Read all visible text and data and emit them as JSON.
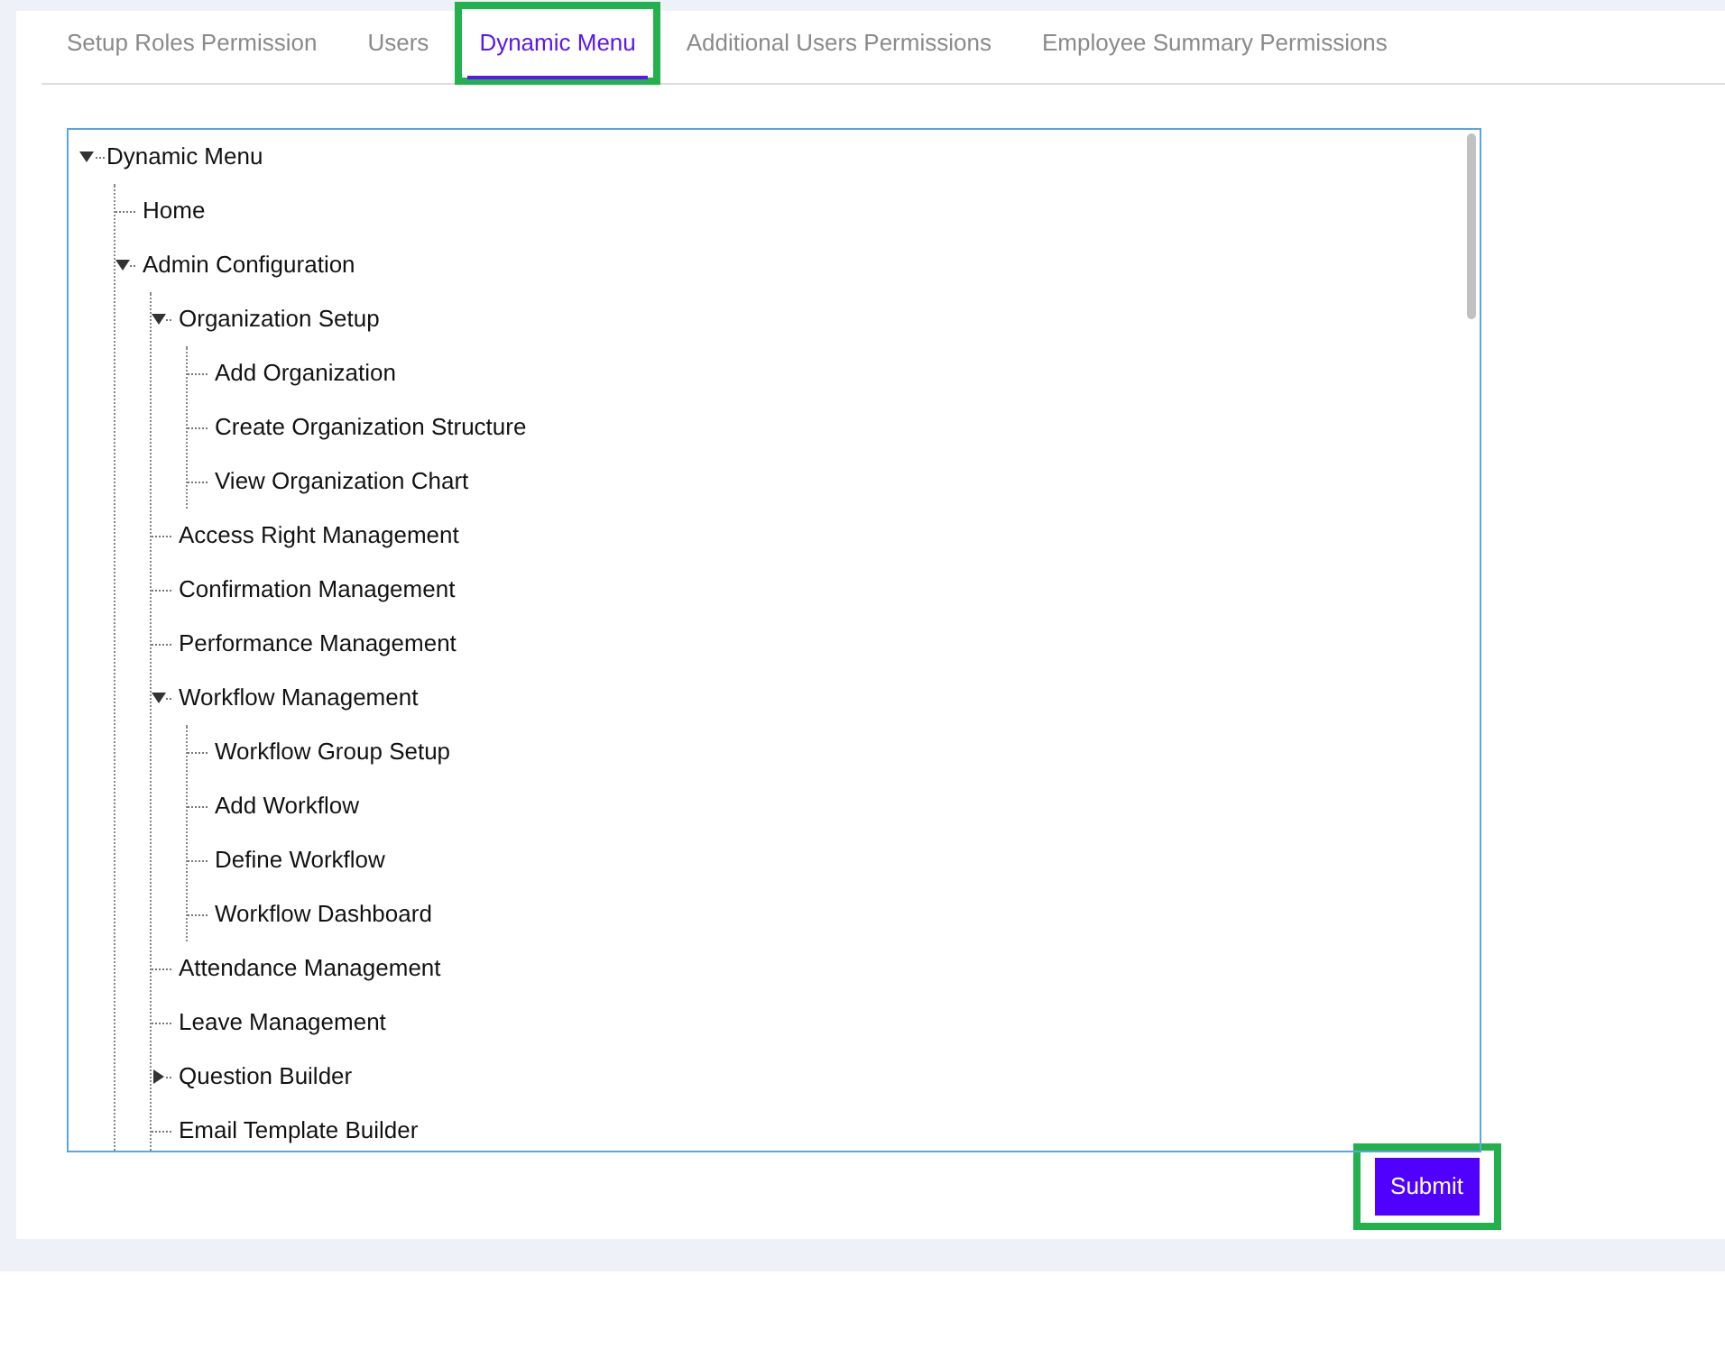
{
  "tabs": [
    {
      "label": "Setup Roles Permission",
      "selected": false,
      "highlighted": false
    },
    {
      "label": "Users",
      "selected": false,
      "highlighted": false
    },
    {
      "label": "Dynamic Menu",
      "selected": true,
      "highlighted": true
    },
    {
      "label": "Additional Users Permissions",
      "selected": false,
      "highlighted": false
    },
    {
      "label": "Employee Summary Permissions",
      "selected": false,
      "highlighted": false
    }
  ],
  "tree": [
    {
      "label": "Dynamic Menu",
      "expanded": true,
      "children": [
        {
          "label": "Home"
        },
        {
          "label": "Admin Configuration",
          "expanded": true,
          "children": [
            {
              "label": "Organization Setup",
              "expanded": true,
              "children": [
                {
                  "label": "Add Organization"
                },
                {
                  "label": "Create Organization Structure"
                },
                {
                  "label": "View Organization Chart"
                }
              ]
            },
            {
              "label": "Access Right Management"
            },
            {
              "label": "Confirmation Management"
            },
            {
              "label": "Performance Management"
            },
            {
              "label": "Workflow Management",
              "expanded": true,
              "children": [
                {
                  "label": "Workflow Group Setup"
                },
                {
                  "label": "Add Workflow"
                },
                {
                  "label": "Define Workflow"
                },
                {
                  "label": "Workflow Dashboard"
                }
              ]
            },
            {
              "label": "Attendance Management"
            },
            {
              "label": "Leave Management"
            },
            {
              "label": "Question Builder",
              "expanded": false
            },
            {
              "label": "Email Template Builder"
            }
          ]
        }
      ]
    }
  ],
  "submit_button": {
    "label": "Submit",
    "highlighted": true
  }
}
